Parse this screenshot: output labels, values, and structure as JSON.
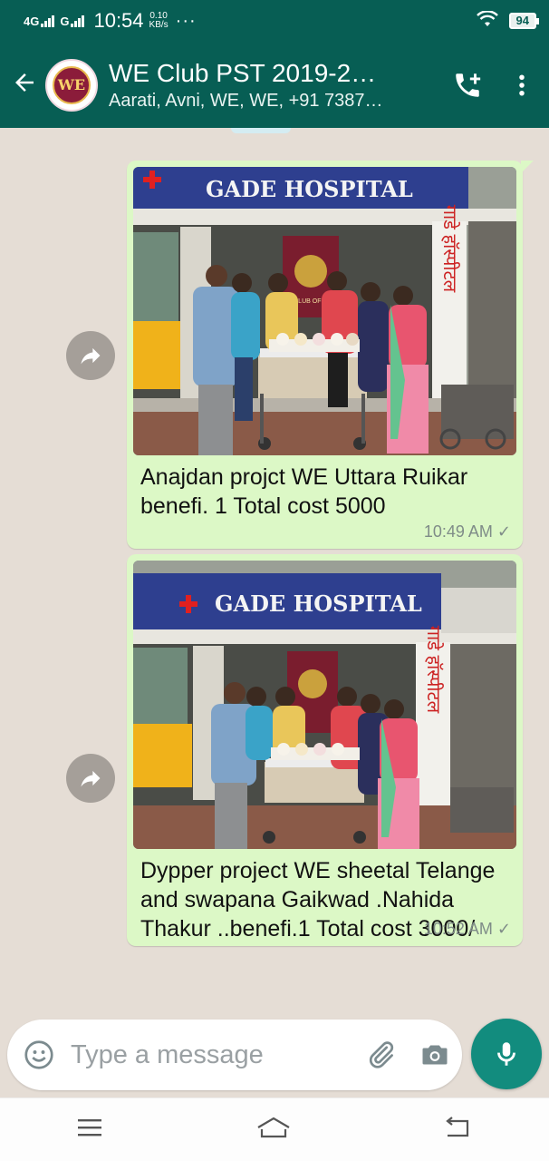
{
  "status_bar": {
    "network_a": "4G",
    "network_b": "G",
    "time": "10:54",
    "speed_value": "0.10",
    "speed_unit": "KB/s",
    "dots": "···",
    "battery": "94"
  },
  "header": {
    "group_name": "WE Club PST 2019-2…",
    "members": "Aarati, Avni, WE, WE, +91 7387…",
    "avatar_text": "WE"
  },
  "photo_signage": {
    "hospital_sign": "GADE HOSPITAL",
    "vertical_sign": "गाडे हॉस्पीटल",
    "banner": "WE CLUB OF INDIA"
  },
  "messages": [
    {
      "caption": "Anajdan projct WE Uttara Ruikar benefi. 1 Total cost 5000",
      "time": "10:49 AM"
    },
    {
      "caption": "Dypper project WE sheetal Telange and swapana Gaikwad .Nahida Thakur ..benefi.1 Total cost 3000/",
      "time": "10:52 AM"
    }
  ],
  "composer": {
    "placeholder": "Type a message"
  },
  "icons": {
    "back": "back-arrow-icon",
    "add_call": "add-call-icon",
    "menu": "more-vert-icon",
    "forward": "forward-icon",
    "emoji": "emoji-icon",
    "attach": "paperclip-icon",
    "camera": "camera-icon",
    "mic": "mic-icon"
  },
  "colors": {
    "header": "#075e54",
    "bubble_out": "#dcf8c6",
    "mic": "#128c7e",
    "chat_bg": "#e5ddd5"
  }
}
